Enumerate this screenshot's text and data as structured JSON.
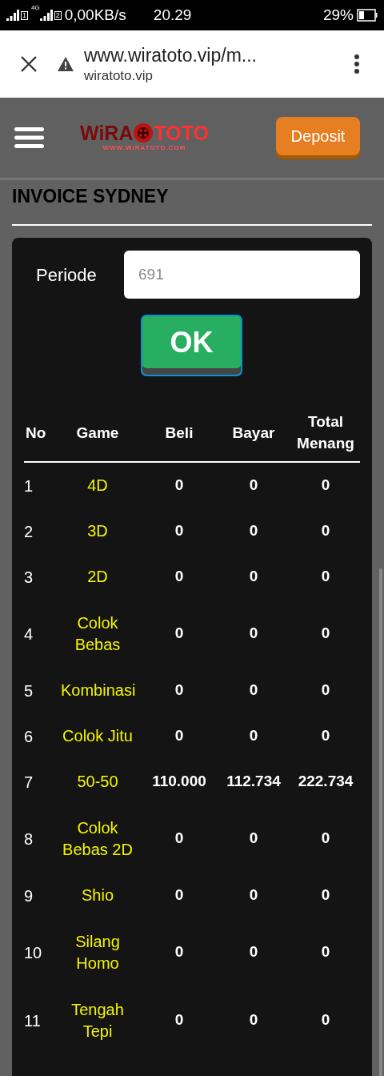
{
  "status_bar": {
    "network_label": "4G",
    "sim_1": "1",
    "sim_2": "2",
    "speed": "0,00KB/s",
    "time": "20.29",
    "battery": "29%"
  },
  "browser": {
    "url": "www.wiratoto.vip/m...",
    "domain": "wiratoto.vip"
  },
  "header": {
    "logo": {
      "left": "WiRA",
      "right": "TOTO",
      "tagline": "WWW.WIRATOTO.COM"
    },
    "deposit_button": "Deposit"
  },
  "page_title": "INVOICE SYDNEY",
  "form": {
    "label": "Periode",
    "placeholder": "691",
    "ok_button": "OK"
  },
  "table": {
    "columns": [
      "No",
      "Game",
      "Beli",
      "Bayar",
      "Total Menang"
    ],
    "rows": [
      {
        "no": "1",
        "game": "4D",
        "beli": "0",
        "bayar": "0",
        "total_menang": "0"
      },
      {
        "no": "2",
        "game": "3D",
        "beli": "0",
        "bayar": "0",
        "total_menang": "0"
      },
      {
        "no": "3",
        "game": "2D",
        "beli": "0",
        "bayar": "0",
        "total_menang": "0"
      },
      {
        "no": "4",
        "game": "Colok Bebas",
        "beli": "0",
        "bayar": "0",
        "total_menang": "0"
      },
      {
        "no": "5",
        "game": "Kombinasi",
        "beli": "0",
        "bayar": "0",
        "total_menang": "0"
      },
      {
        "no": "6",
        "game": "Colok Jitu",
        "beli": "0",
        "bayar": "0",
        "total_menang": "0"
      },
      {
        "no": "7",
        "game": "50-50",
        "beli": "110.000",
        "bayar": "112.734",
        "total_menang": "222.734"
      },
      {
        "no": "8",
        "game": "Colok Bebas 2D",
        "beli": "0",
        "bayar": "0",
        "total_menang": "0"
      },
      {
        "no": "9",
        "game": "Shio",
        "beli": "0",
        "bayar": "0",
        "total_menang": "0"
      },
      {
        "no": "10",
        "game": "Silang Homo",
        "beli": "0",
        "bayar": "0",
        "total_menang": "0"
      },
      {
        "no": "11",
        "game": "Tengah Tepi",
        "beli": "0",
        "bayar": "0",
        "total_menang": "0"
      }
    ]
  }
}
